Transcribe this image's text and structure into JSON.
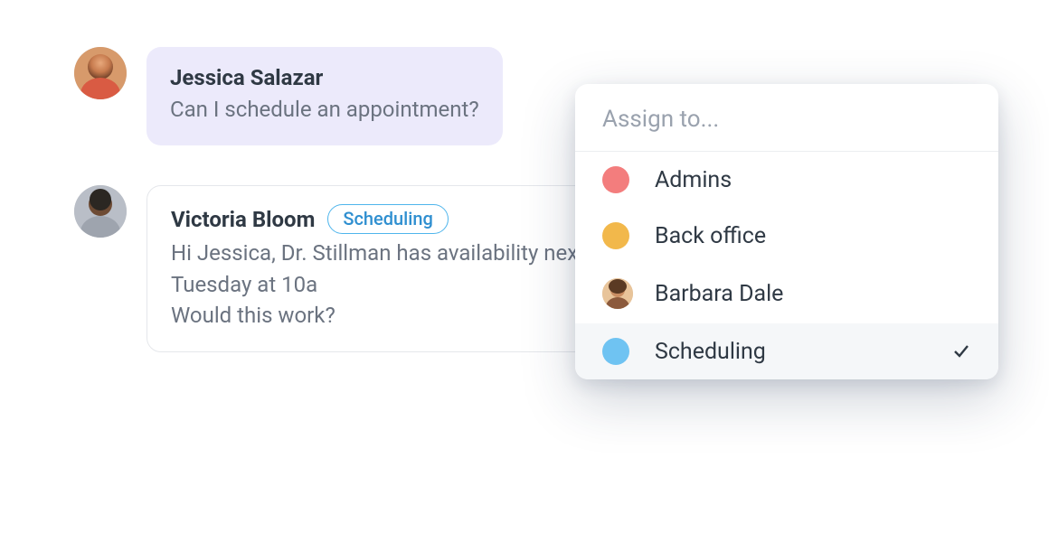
{
  "chat": {
    "messages": [
      {
        "author": "Jessica Salazar",
        "text": "Can I schedule an appointment?",
        "bubble": "purple",
        "tag": null
      },
      {
        "author": "Victoria Bloom",
        "text": "Hi Jessica, Dr. Stillman has availability next Tuesday at 10a\nWould this work?",
        "bubble": "white",
        "tag": "Scheduling"
      }
    ]
  },
  "assign": {
    "placeholder": "Assign to...",
    "items": [
      {
        "kind": "swatch",
        "color": "#F37D7D",
        "label": "Admins",
        "selected": false
      },
      {
        "kind": "swatch",
        "color": "#F2B84B",
        "label": "Back office",
        "selected": false
      },
      {
        "kind": "avatar",
        "label": "Barbara Dale",
        "selected": false
      },
      {
        "kind": "swatch",
        "color": "#6FC3F2",
        "label": "Scheduling",
        "selected": true
      }
    ]
  }
}
